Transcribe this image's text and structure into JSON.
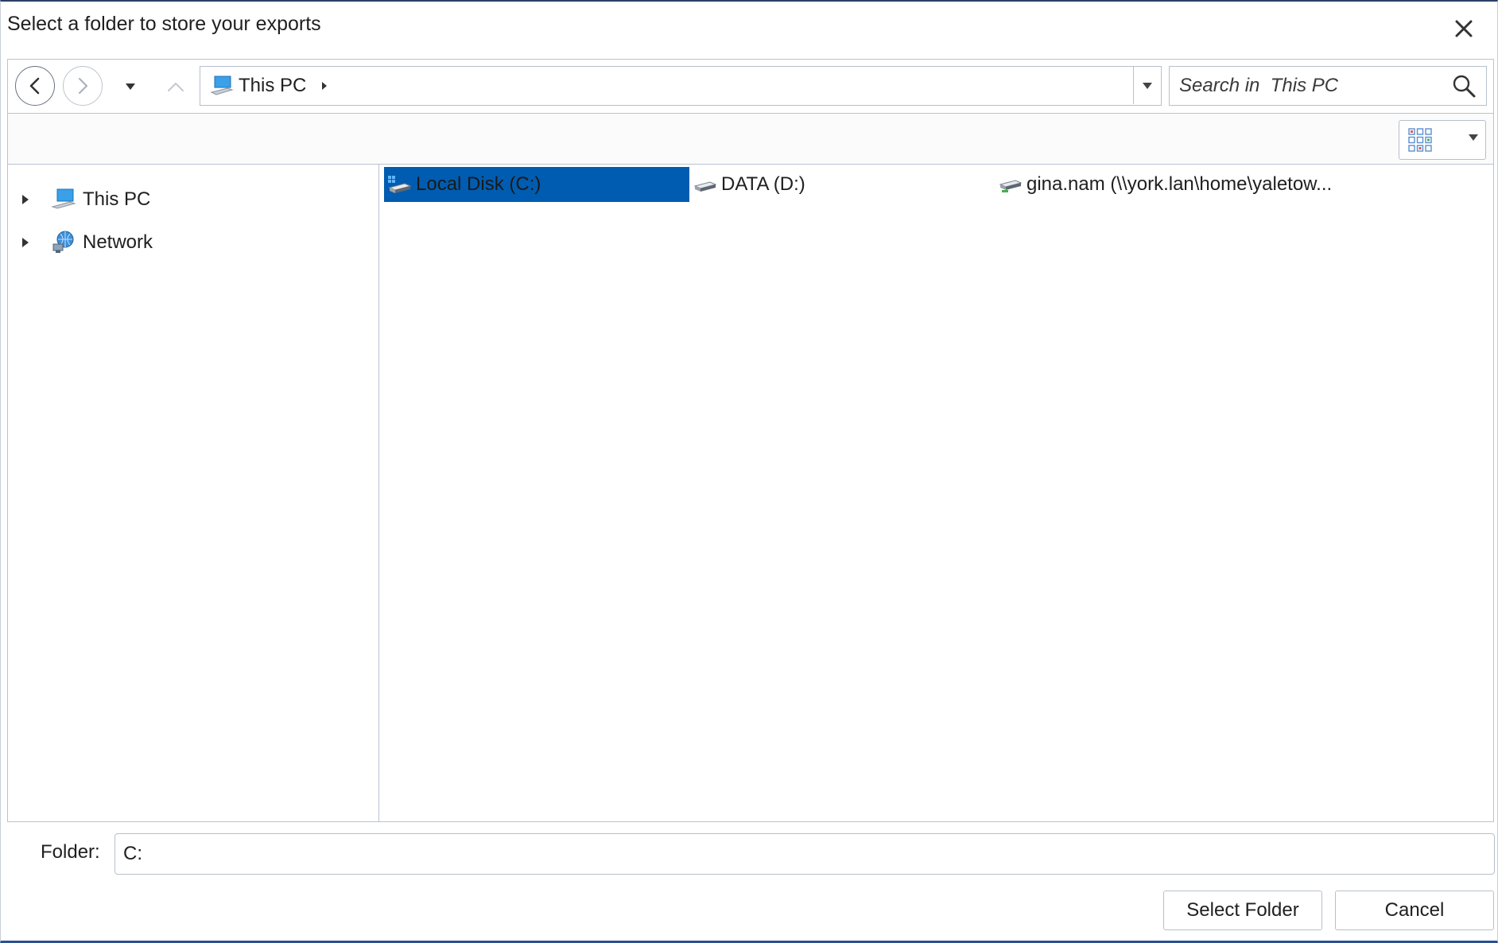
{
  "dialog": {
    "title": "Select a folder to store your exports"
  },
  "navigation": {
    "back_icon": "chevron-left-icon",
    "forward_icon": "chevron-right-icon",
    "recent_icon": "caret-down-icon",
    "up_icon": "chevron-up-icon"
  },
  "address": {
    "location": "This PC",
    "location_icon": "computer-icon"
  },
  "search": {
    "placeholder": "Search in  This PC",
    "icon": "search-icon"
  },
  "view": {
    "icon": "grid-view-icon"
  },
  "tree": {
    "items": [
      {
        "label": "This PC",
        "icon": "computer-icon"
      },
      {
        "label": "Network",
        "icon": "network-icon"
      }
    ]
  },
  "drives": {
    "items": [
      {
        "label": "Local Disk (C:)",
        "icon": "windows-drive-icon",
        "selected": true
      },
      {
        "label": "DATA (D:)",
        "icon": "drive-icon",
        "selected": false
      },
      {
        "label": "gina.nam (\\\\york.lan\\home\\yaletow...",
        "icon": "network-drive-icon",
        "selected": false
      }
    ]
  },
  "folder": {
    "label": "Folder:",
    "value": "C:"
  },
  "buttons": {
    "select_label": "Select Folder",
    "cancel_label": "Cancel"
  },
  "colors": {
    "selection": "#005cb0",
    "border": "#b7c0cc",
    "frame_accent": "#2b4f8f"
  }
}
